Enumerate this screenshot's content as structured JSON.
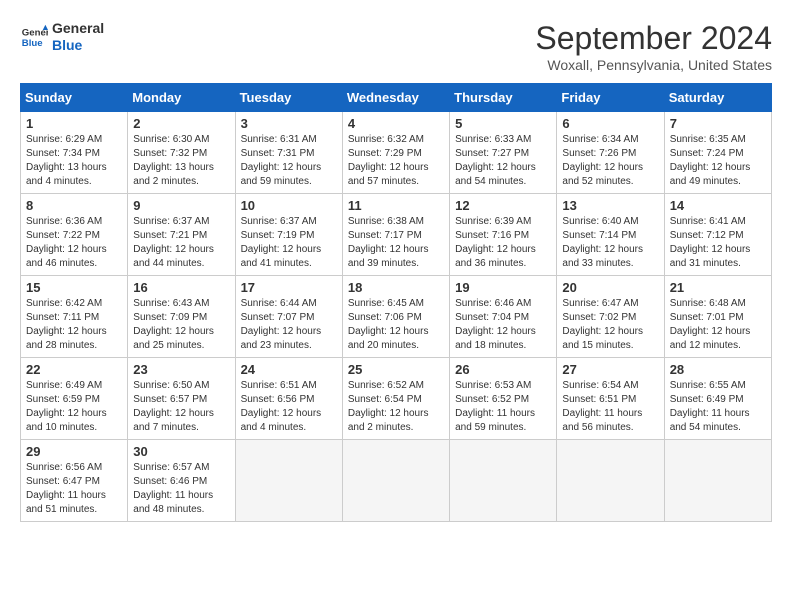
{
  "logo": {
    "line1": "General",
    "line2": "Blue"
  },
  "title": "September 2024",
  "location": "Woxall, Pennsylvania, United States",
  "days_of_week": [
    "Sunday",
    "Monday",
    "Tuesday",
    "Wednesday",
    "Thursday",
    "Friday",
    "Saturday"
  ],
  "weeks": [
    [
      {
        "day": "1",
        "sunrise": "6:29 AM",
        "sunset": "7:34 PM",
        "daylight": "13 hours and 4 minutes."
      },
      {
        "day": "2",
        "sunrise": "6:30 AM",
        "sunset": "7:32 PM",
        "daylight": "13 hours and 2 minutes."
      },
      {
        "day": "3",
        "sunrise": "6:31 AM",
        "sunset": "7:31 PM",
        "daylight": "12 hours and 59 minutes."
      },
      {
        "day": "4",
        "sunrise": "6:32 AM",
        "sunset": "7:29 PM",
        "daylight": "12 hours and 57 minutes."
      },
      {
        "day": "5",
        "sunrise": "6:33 AM",
        "sunset": "7:27 PM",
        "daylight": "12 hours and 54 minutes."
      },
      {
        "day": "6",
        "sunrise": "6:34 AM",
        "sunset": "7:26 PM",
        "daylight": "12 hours and 52 minutes."
      },
      {
        "day": "7",
        "sunrise": "6:35 AM",
        "sunset": "7:24 PM",
        "daylight": "12 hours and 49 minutes."
      }
    ],
    [
      {
        "day": "8",
        "sunrise": "6:36 AM",
        "sunset": "7:22 PM",
        "daylight": "12 hours and 46 minutes."
      },
      {
        "day": "9",
        "sunrise": "6:37 AM",
        "sunset": "7:21 PM",
        "daylight": "12 hours and 44 minutes."
      },
      {
        "day": "10",
        "sunrise": "6:37 AM",
        "sunset": "7:19 PM",
        "daylight": "12 hours and 41 minutes."
      },
      {
        "day": "11",
        "sunrise": "6:38 AM",
        "sunset": "7:17 PM",
        "daylight": "12 hours and 39 minutes."
      },
      {
        "day": "12",
        "sunrise": "6:39 AM",
        "sunset": "7:16 PM",
        "daylight": "12 hours and 36 minutes."
      },
      {
        "day": "13",
        "sunrise": "6:40 AM",
        "sunset": "7:14 PM",
        "daylight": "12 hours and 33 minutes."
      },
      {
        "day": "14",
        "sunrise": "6:41 AM",
        "sunset": "7:12 PM",
        "daylight": "12 hours and 31 minutes."
      }
    ],
    [
      {
        "day": "15",
        "sunrise": "6:42 AM",
        "sunset": "7:11 PM",
        "daylight": "12 hours and 28 minutes."
      },
      {
        "day": "16",
        "sunrise": "6:43 AM",
        "sunset": "7:09 PM",
        "daylight": "12 hours and 25 minutes."
      },
      {
        "day": "17",
        "sunrise": "6:44 AM",
        "sunset": "7:07 PM",
        "daylight": "12 hours and 23 minutes."
      },
      {
        "day": "18",
        "sunrise": "6:45 AM",
        "sunset": "7:06 PM",
        "daylight": "12 hours and 20 minutes."
      },
      {
        "day": "19",
        "sunrise": "6:46 AM",
        "sunset": "7:04 PM",
        "daylight": "12 hours and 18 minutes."
      },
      {
        "day": "20",
        "sunrise": "6:47 AM",
        "sunset": "7:02 PM",
        "daylight": "12 hours and 15 minutes."
      },
      {
        "day": "21",
        "sunrise": "6:48 AM",
        "sunset": "7:01 PM",
        "daylight": "12 hours and 12 minutes."
      }
    ],
    [
      {
        "day": "22",
        "sunrise": "6:49 AM",
        "sunset": "6:59 PM",
        "daylight": "12 hours and 10 minutes."
      },
      {
        "day": "23",
        "sunrise": "6:50 AM",
        "sunset": "6:57 PM",
        "daylight": "12 hours and 7 minutes."
      },
      {
        "day": "24",
        "sunrise": "6:51 AM",
        "sunset": "6:56 PM",
        "daylight": "12 hours and 4 minutes."
      },
      {
        "day": "25",
        "sunrise": "6:52 AM",
        "sunset": "6:54 PM",
        "daylight": "12 hours and 2 minutes."
      },
      {
        "day": "26",
        "sunrise": "6:53 AM",
        "sunset": "6:52 PM",
        "daylight": "11 hours and 59 minutes."
      },
      {
        "day": "27",
        "sunrise": "6:54 AM",
        "sunset": "6:51 PM",
        "daylight": "11 hours and 56 minutes."
      },
      {
        "day": "28",
        "sunrise": "6:55 AM",
        "sunset": "6:49 PM",
        "daylight": "11 hours and 54 minutes."
      }
    ],
    [
      {
        "day": "29",
        "sunrise": "6:56 AM",
        "sunset": "6:47 PM",
        "daylight": "11 hours and 51 minutes."
      },
      {
        "day": "30",
        "sunrise": "6:57 AM",
        "sunset": "6:46 PM",
        "daylight": "11 hours and 48 minutes."
      },
      null,
      null,
      null,
      null,
      null
    ]
  ]
}
